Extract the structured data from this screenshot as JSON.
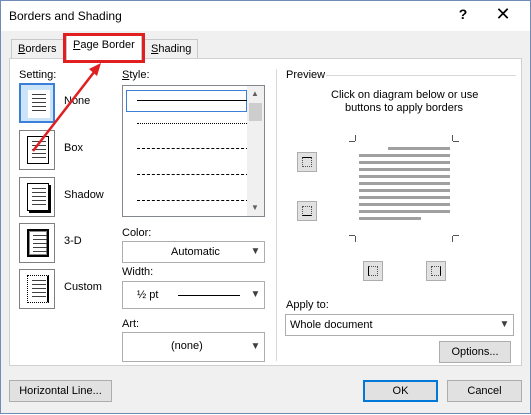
{
  "window": {
    "title": "Borders and Shading",
    "help_glyph": "?",
    "close_glyph": "✕"
  },
  "tabs": [
    {
      "label_pre": "",
      "label_u": "B",
      "label_post": "orders"
    },
    {
      "label_pre": "",
      "label_u": "P",
      "label_post": "age Border"
    },
    {
      "label_pre": "",
      "label_u": "S",
      "label_post": "hading"
    }
  ],
  "setting": {
    "label": "Setting:",
    "items": [
      "None",
      "Box",
      "Shadow",
      "3-D",
      "Custom"
    ],
    "underline": [
      "N",
      "x",
      "a",
      "D",
      "u"
    ]
  },
  "style": {
    "label_u": "S",
    "label_rest": "tyle:",
    "selected_index": 0
  },
  "color": {
    "label": "Color:",
    "value": "Automatic"
  },
  "width": {
    "label": "Width:",
    "value": "½ pt"
  },
  "art": {
    "label": "Art:",
    "value": "(none)"
  },
  "preview": {
    "label": "Preview",
    "instructions_line1": "Click on diagram below or use",
    "instructions_line2": "buttons to apply borders"
  },
  "apply_to": {
    "label": "Apply to:",
    "value": "Whole document"
  },
  "buttons": {
    "options": "Options...",
    "horizontal_line": "Horizontal Line...",
    "ok": "OK",
    "cancel": "Cancel"
  },
  "colors": {
    "highlight_red": "#e02020",
    "accent": "#0078d7"
  }
}
